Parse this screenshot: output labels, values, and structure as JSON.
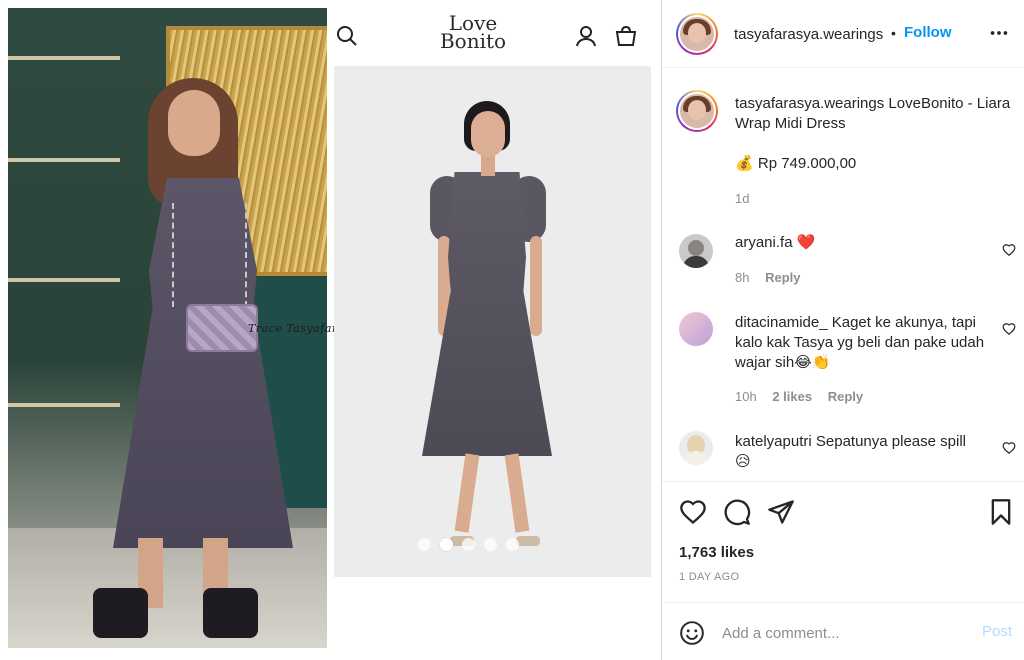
{
  "media": {
    "watermark": "Trace Tasyafarasya.wearings",
    "site_logo_line1": "Love",
    "site_logo_line2": "Bonito",
    "carousel_dots": 5,
    "carousel_active_index": 1
  },
  "header": {
    "username": "tasyafarasya.wearings",
    "separator": "•",
    "follow_label": "Follow"
  },
  "caption": {
    "username": "tasyafarasya.wearings",
    "text": "LoveBonito - Liara Wrap Midi Dress",
    "price_emoji": "💰",
    "price": "Rp 749.000,00",
    "time": "1d"
  },
  "comments": [
    {
      "username": "aryani.fa",
      "text": "",
      "emoji": "❤️",
      "time": "8h",
      "likes": "",
      "reply_label": "Reply"
    },
    {
      "username": "ditacinamide_",
      "text": "Kaget ke akunya, tapi kalo kak Tasya yg beli dan pake udah wajar sih",
      "emoji": "😂👏",
      "time": "10h",
      "likes": "2 likes",
      "reply_label": "Reply"
    },
    {
      "username": "katelyaputri",
      "text": "Sepatunya please spill",
      "emoji": "😥",
      "time": "",
      "likes": "",
      "reply_label": ""
    }
  ],
  "actions": {
    "likes": "1,763 likes",
    "date": "1 DAY AGO"
  },
  "add_comment": {
    "placeholder": "Add a comment...",
    "post_label": "Post"
  },
  "colors": {
    "accent": "#0095f6",
    "post_disabled": "#b3dbff",
    "heart": "#ed4956",
    "muted": "#8e8e8e"
  },
  "icons": [
    "search-icon",
    "user-icon",
    "cart-icon",
    "more-icon",
    "heart-icon",
    "comment-icon",
    "share-icon",
    "bookmark-icon",
    "emoji-icon"
  ]
}
